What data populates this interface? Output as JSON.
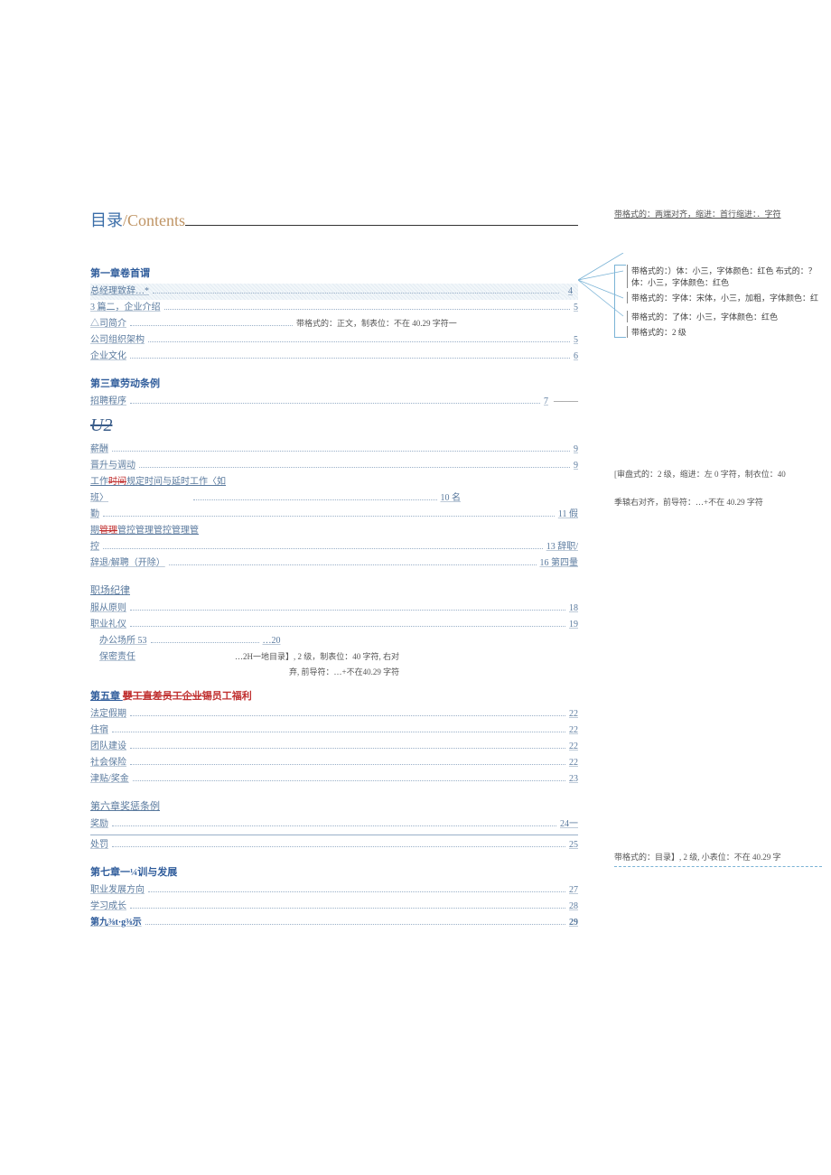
{
  "title_cn": "目录",
  "title_en": "/Contents",
  "annotations": {
    "top": "带格式的：两端对齐，缩进：首行缩进：．字符",
    "box1": "带格式的：）体：小三，字体颜色：红色 布式的：？体：小三，字体颜色：红色",
    "box2": "带格式的：字体：宋体，小三，加粗，字体颜色：红",
    "box3": "带格式的：了体：小三，字体颜色：红色",
    "box4": "带格式的：2 级",
    "right_mid1": "[审盘式的：2 级，缩进：左 0 字符，制衣位：40",
    "right_mid2": "季辕右对齐，前导符：…+不在 40.29 字符",
    "right_bottom": "带格式的：目录】, 2 级, 小表位：不在 40.29 字"
  },
  "chapters": {
    "ch1": "第一章卷首谓",
    "ch3": "第三章劳动条例",
    "ch4t": "职场纪律",
    "ch5": "第五章 ",
    "ch5_strike": "嬰工直差员工企业锡",
    "ch5_after": "员工福利",
    "ch6": "第六章奖惩条例",
    "ch7": "第七章一¼训与发展",
    "ch9": "第九⅜t·g⅜示"
  },
  "u2": "U2",
  "toc": {
    "l1": {
      "label": "总经理致辞…*",
      "pg": "4"
    },
    "l2": {
      "label": "3 篇二，企业介绍",
      "pg": "5"
    },
    "l3": {
      "label": "△司简介 ",
      "note": "带格式的：正文，制表位：不在 40.29 字符一"
    },
    "l4": {
      "label": "公司组织架构",
      "pg": "5"
    },
    "l5": {
      "label": "企业文化",
      "pg": "6"
    },
    "l6": {
      "label": "招聘程序",
      "pg": "7"
    },
    "l7": {
      "label": "薪酬",
      "pg": "9"
    },
    "l8": {
      "label": "晋升与调动",
      "pg": "9"
    },
    "l9a": "工作",
    "l9strike": "时间",
    "l9b": "规定时间",
    "l9c": "与延时工作〈如",
    "l10": {
      "label": "班〉",
      "pg": "10 名"
    },
    "l11": {
      "label": "勤",
      "pg": "11 假"
    },
    "l12a": "期",
    "l12s": "管理",
    "l12b": "管控管理管控管理管",
    "l13": {
      "label": "控",
      "pg": "13 辞职/"
    },
    "l14": {
      "label": "辞退/解聘（开除）",
      "pg": "16 第四量"
    },
    "l15": {
      "label": "服从原则",
      "pg": "18"
    },
    "l16": {
      "label": "职业礼仪",
      "pg": "19"
    },
    "l17": {
      "label": "办公场所 53",
      "pg": "…20"
    },
    "l18": {
      "label": "保密责任",
      "note1": "…2H一地目录】, 2 级，制表位：40 字符, 右对",
      "note2": "弃, 前导符：…+不在40.29 字符"
    },
    "l19": {
      "label": "法定假期",
      "pg": "22"
    },
    "l20": {
      "label": "住宿",
      "pg": "22"
    },
    "l21": {
      "label": "团队建设",
      "pg": "22"
    },
    "l22": {
      "label": "社会保险",
      "pg": "22"
    },
    "l23": {
      "label": "津贴/奖金",
      "pg": "23"
    },
    "l24": {
      "label": "奖励",
      "pg": "24一"
    },
    "l25": {
      "label": "处罚",
      "pg": "25"
    },
    "l26": {
      "label": "职业发展方向",
      "pg": "27"
    },
    "l27": {
      "label": "学习成长",
      "pg": "28"
    },
    "l28": {
      "pg": "29"
    }
  }
}
